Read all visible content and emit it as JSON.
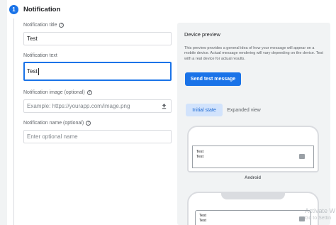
{
  "section": {
    "step_number": "1",
    "title": "Notification"
  },
  "fields": {
    "title": {
      "label": "Notification title",
      "value": "Test"
    },
    "text": {
      "label": "Notification text",
      "value": "Test"
    },
    "image": {
      "label": "Notification image (optional)",
      "placeholder": "Example: https://yourapp.com/image.png"
    },
    "name": {
      "label": "Notification name (optional)",
      "placeholder": "Enter optional name"
    }
  },
  "icons": {
    "help": "help-circle-icon",
    "upload": "upload-icon",
    "image_placeholder": "image-icon"
  },
  "preview": {
    "title": "Device preview",
    "description": "This preview provides a general idea of how your message will appear on a mobile device. Actual message rendering will vary depending on the device. Test with a real device for actual results.",
    "send_button": "Send test message",
    "tabs": [
      {
        "label": "Initial state",
        "active": true
      },
      {
        "label": "Expanded view",
        "active": false
      }
    ],
    "android_card": {
      "title": "Test",
      "text": "Test"
    },
    "platform_label": "Android",
    "second_card": {
      "title": "Test",
      "text": "Test"
    }
  },
  "watermark": {
    "line1": "Activate W",
    "line2": "Go to Settin"
  },
  "colors": {
    "accent": "#1a73e8",
    "tab_active_bg": "#d2e3fc",
    "panel_bg": "#f1f3f4"
  }
}
